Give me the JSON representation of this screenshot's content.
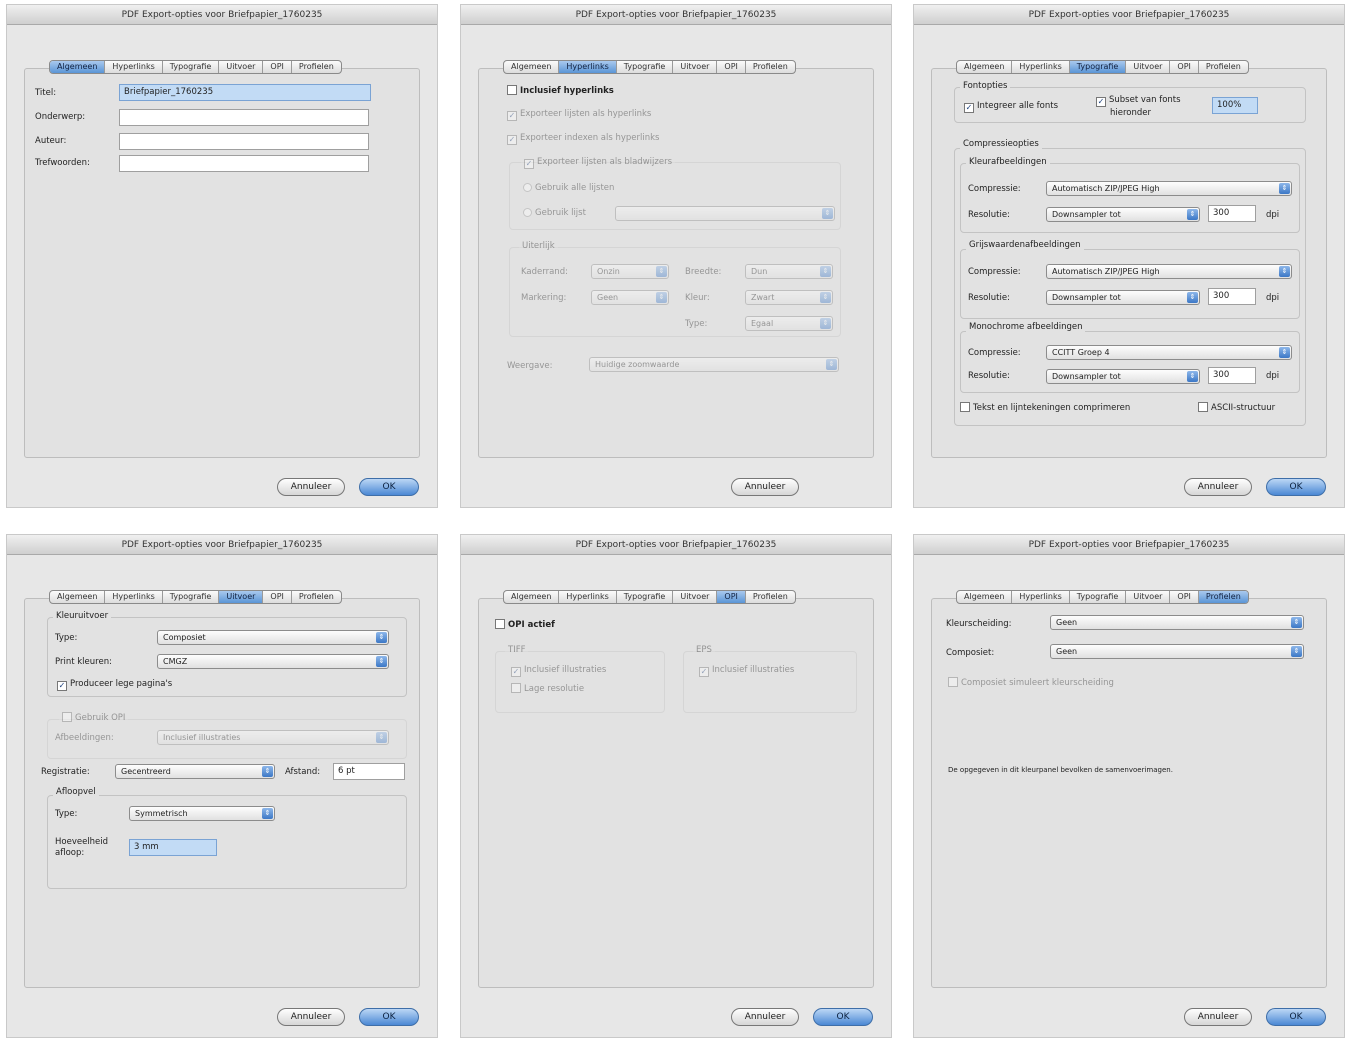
{
  "dialog_title": "PDF Export-opties voor Briefpapier_1760235",
  "tabs": [
    "Algemeen",
    "Hyperlinks",
    "Typografie",
    "Uitvoer",
    "OPI",
    "Profielen"
  ],
  "buttons": {
    "cancel": "Annuleer",
    "ok": "OK"
  },
  "general": {
    "title_label": "Titel:",
    "title_value": "Briefpapier_1760235",
    "subject_label": "Onderwerp:",
    "subject_value": "",
    "author_label": "Auteur:",
    "author_value": "",
    "keywords_label": "Trefwoorden:",
    "keywords_value": ""
  },
  "hyperlinks": {
    "include": "Inclusief hyperlinks",
    "export_lists": "Exporteer lijsten als hyperlinks",
    "export_index": "Exporteer indexen als hyperlinks",
    "export_bookmarks": "Exporteer lijsten als bladwijzers",
    "radio_all": "Gebruik alle lijsten",
    "radio_list": "Gebruik lijst",
    "appearance": "Uiterlijk",
    "frame_label": "Kaderrand:",
    "frame_value": "Onzin",
    "width_label": "Breedte:",
    "width_value": "Dun",
    "highlight_label": "Markering:",
    "highlight_value": "Geen",
    "color_label": "Kleur:",
    "color_value": "Zwart",
    "style_label": "Type:",
    "style_value": "Egaal",
    "display_label": "Weergave:",
    "display_value": "Huidige zoomwaarde"
  },
  "typography": {
    "fonts_group": "Fontopties",
    "embed": "Integreer alle fonts",
    "subset": "Subset van fonts",
    "subset2": "hieronder",
    "subset_pct": "100%",
    "compression": "Compressieopties",
    "color_images": "Kleurafbeeldingen",
    "gray_images": "Grijswaardenafbeeldingen",
    "mono_images": "Monochrome afbeeldingen",
    "comp_label": "Compressie:",
    "res_label": "Resolutie:",
    "comp_color": "Automatisch ZIP/JPEG High",
    "comp_gray": "Automatisch ZIP/JPEG High",
    "comp_mono": "CCITT Groep 4",
    "res_value": "Downsampler tot",
    "dpi": "300",
    "dpi_mono": "300",
    "dpi_unit": "dpi",
    "compress_text": "Tekst en lijntekeningen comprimeren",
    "ascii": "ASCII-structuur"
  },
  "output": {
    "color_group": "Kleuruitvoer",
    "type_label": "Type:",
    "type_value": "Composiet",
    "print_label": "Print kleuren:",
    "print_value": "CMGZ",
    "blank_pages": "Produceer lege pagina's",
    "opi_group": "Gebruik OPI",
    "images_label": "Afbeeldingen:",
    "images_value": "Inclusief illustraties",
    "reg_label": "Registratie:",
    "reg_value": "Gecentreerd",
    "offset_label": "Afstand:",
    "offset_value": "6 pt",
    "bleed_group": "Afloopvel",
    "bleed_type_label": "Type:",
    "bleed_type_value": "Symmetrisch",
    "bleed_amount_label1": "Hoeveelheid",
    "bleed_amount_label2": "afloop:",
    "bleed_amount_value": "3 mm"
  },
  "opi": {
    "active": "OPI actief",
    "tiff_group": "TIFF",
    "tiff_include": "Inclusief illustraties",
    "tiff_lowres": "Lage resolutie",
    "eps_group": "EPS",
    "eps_include": "Inclusief illustraties"
  },
  "profiles": {
    "sep_label": "Kleurscheiding:",
    "sep_value": "Geen",
    "comp_label": "Composiet:",
    "comp_value": "Geen",
    "composite_sim": "Composiet simuleert kleurscheiding",
    "note": "De opgegeven in dit kleurpanel bevolken de samenvoerimagen."
  }
}
